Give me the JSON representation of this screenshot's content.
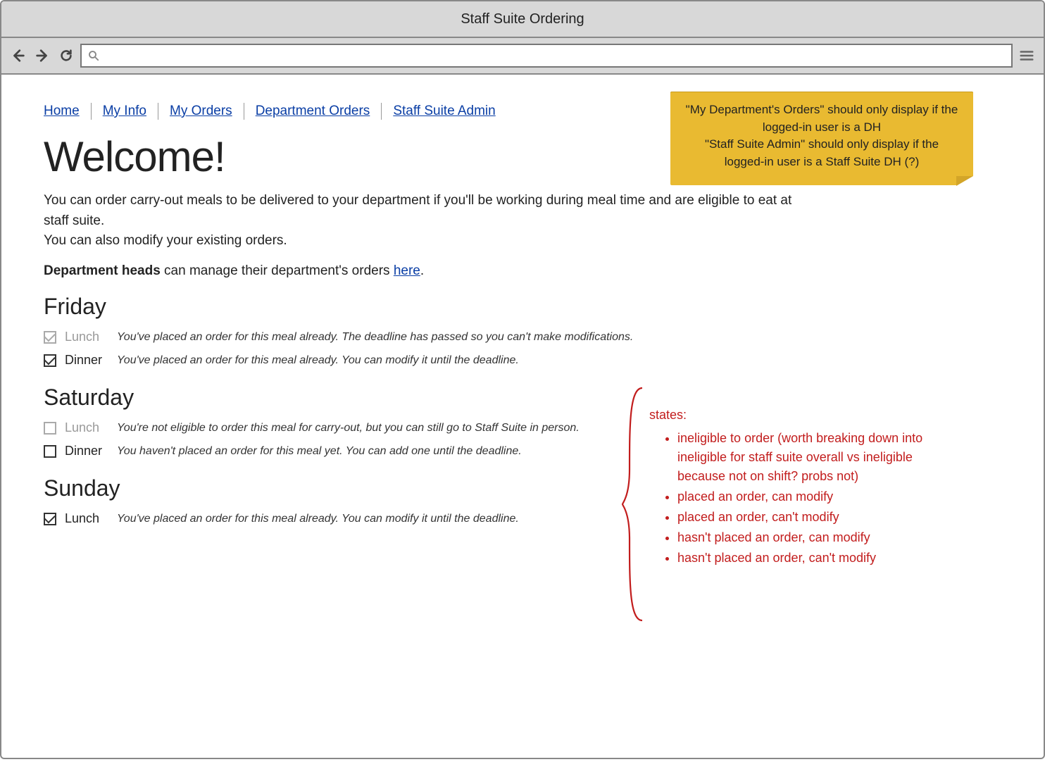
{
  "window_title": "Staff Suite Ordering",
  "url_value": "",
  "nav": {
    "items": [
      {
        "label": "Home"
      },
      {
        "label": "My Info"
      },
      {
        "label": "My Orders"
      },
      {
        "label": "Department Orders"
      },
      {
        "label": "Staff Suite Admin"
      }
    ]
  },
  "page_heading": "Welcome!",
  "intro": {
    "line1": "You can order carry-out meals to be delivered to your department if you'll be working during meal time and are eligible to eat at staff suite.",
    "line2": "You can also modify your existing orders.",
    "dh_prefix": "Department heads",
    "dh_rest": " can manage their department's orders ",
    "here_label": "here",
    "dh_suffix": "."
  },
  "days": [
    {
      "name": "Friday",
      "meals": [
        {
          "name": "Lunch",
          "checked": true,
          "disabled": true,
          "status": "You've placed an order for this meal already. The deadline has passed so you can't make modifications."
        },
        {
          "name": "Dinner",
          "checked": true,
          "disabled": false,
          "status": "You've placed an order for this meal already. You can modify it until the deadline."
        }
      ]
    },
    {
      "name": "Saturday",
      "meals": [
        {
          "name": "Lunch",
          "checked": false,
          "disabled": true,
          "status": "You're not eligible to order this meal for carry-out, but you can still go to Staff Suite in person."
        },
        {
          "name": "Dinner",
          "checked": false,
          "disabled": false,
          "status": "You haven't placed an order for this meal yet. You can add one until the deadline."
        }
      ]
    },
    {
      "name": "Sunday",
      "meals": [
        {
          "name": "Lunch",
          "checked": true,
          "disabled": false,
          "status": "You've placed an order for this meal already. You can modify it until the deadline."
        }
      ]
    }
  ],
  "sticky_note": {
    "line1": "\"My Department's Orders\" should only display if the logged-in user is a DH",
    "line2": "\"Staff Suite Admin\" should only display if the logged-in user is a Staff Suite DH (?)"
  },
  "annotation": {
    "heading": "states:",
    "items": [
      "ineligible to order (worth breaking down into ineligible for staff suite overall vs ineligible because not on shift? probs not)",
      "placed an order, can modify",
      "placed an order, can't modify",
      "hasn't placed an order, can modify",
      "hasn't placed an order, can't modify"
    ]
  }
}
